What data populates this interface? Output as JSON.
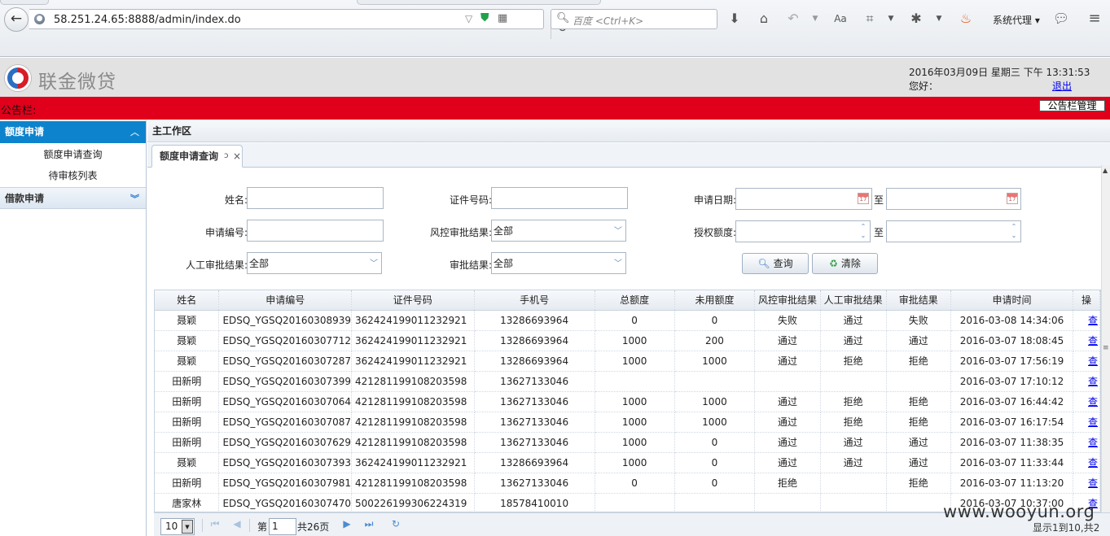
{
  "browser": {
    "url": "58.251.24.65:8888/admin/index.do",
    "search_placeholder": "百度 <Ctrl+K>",
    "proxy_label": "系统代理"
  },
  "app": {
    "name": "联金微贷",
    "datetime": "2016年03月09日 星期三 下午 13:31:53",
    "greeting": "您好：",
    "logout": "退出"
  },
  "notice": {
    "label": "公告栏:",
    "manage_button": "公告栏管理"
  },
  "sidebar": {
    "sections": [
      {
        "title": "额度申请",
        "items": [
          "额度申请查询",
          "待审核列表"
        ]
      },
      {
        "title": "借款申请",
        "items": []
      }
    ]
  },
  "workarea": {
    "title": "主工作区",
    "tab_label": "额度申请查询"
  },
  "form": {
    "name_label": "姓名:",
    "idno_label": "证件号码:",
    "apply_date_label": "申请日期:",
    "apply_no_label": "申请编号:",
    "risk_result_label": "风控审批结果:",
    "risk_result_value": "全部",
    "credit_label": "授权额度:",
    "manual_result_label": "人工审批结果:",
    "manual_result_value": "全部",
    "approve_result_label": "审批结果:",
    "approve_result_value": "全部",
    "to_label": "至",
    "query_button": "查询",
    "clear_button": "清除"
  },
  "table": {
    "columns": [
      "姓名",
      "申请编号",
      "证件号码",
      "手机号",
      "总额度",
      "未用额度",
      "风控审批结果",
      "人工审批结果",
      "审批结果",
      "申请时间",
      "操"
    ],
    "rows": [
      [
        "聂颖",
        "EDSQ_YGSQ20160308939",
        "362424199011232921",
        "13286693964",
        "0",
        "0",
        "失败",
        "通过",
        "失败",
        "2016-03-08 14:34:06",
        "查"
      ],
      [
        "聂颖",
        "EDSQ_YGSQ20160307712",
        "362424199011232921",
        "13286693964",
        "1000",
        "200",
        "通过",
        "通过",
        "通过",
        "2016-03-07 18:08:45",
        "查"
      ],
      [
        "聂颖",
        "EDSQ_YGSQ20160307287",
        "362424199011232921",
        "13286693964",
        "1000",
        "1000",
        "通过",
        "拒绝",
        "拒绝",
        "2016-03-07 17:56:19",
        "查"
      ],
      [
        "田新明",
        "EDSQ_YGSQ20160307399",
        "421281199108203598",
        "13627133046",
        "",
        "",
        "",
        "",
        "",
        "2016-03-07 17:10:12",
        "查"
      ],
      [
        "田新明",
        "EDSQ_YGSQ20160307064",
        "421281199108203598",
        "13627133046",
        "1000",
        "1000",
        "通过",
        "拒绝",
        "拒绝",
        "2016-03-07 16:44:42",
        "查"
      ],
      [
        "田新明",
        "EDSQ_YGSQ20160307087",
        "421281199108203598",
        "13627133046",
        "1000",
        "1000",
        "通过",
        "拒绝",
        "拒绝",
        "2016-03-07 16:17:54",
        "查"
      ],
      [
        "田新明",
        "EDSQ_YGSQ20160307629",
        "421281199108203598",
        "13627133046",
        "1000",
        "0",
        "通过",
        "通过",
        "通过",
        "2016-03-07 11:38:35",
        "查"
      ],
      [
        "聂颖",
        "EDSQ_YGSQ20160307393",
        "362424199011232921",
        "13286693964",
        "1000",
        "0",
        "通过",
        "通过",
        "通过",
        "2016-03-07 11:33:44",
        "查"
      ],
      [
        "田新明",
        "EDSQ_YGSQ20160307981",
        "421281199108203598",
        "13627133046",
        "0",
        "0",
        "拒绝",
        "",
        "拒绝",
        "2016-03-07 11:13:20",
        "查"
      ],
      [
        "唐家林",
        "EDSQ_YGSQ20160307470",
        "500226199306224319",
        "18578410010",
        "",
        "",
        "",
        "",
        "",
        "2016-03-07 10:37:00",
        "查"
      ]
    ]
  },
  "pager": {
    "page_size": "10",
    "page_label": "第",
    "page_value": "1",
    "total_label": "共26页",
    "info": "显示1到10,共2"
  },
  "watermark": "www.wooyun.org"
}
